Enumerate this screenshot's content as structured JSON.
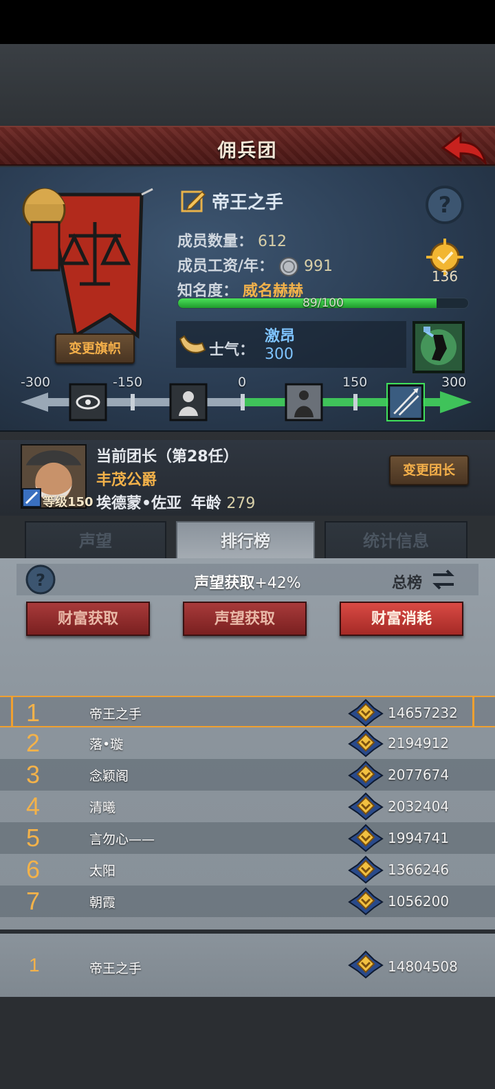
{
  "header": {
    "title": "佣兵团"
  },
  "guild": {
    "name": "帝王之手",
    "member_count_label": "成员数量：",
    "member_count": "612",
    "salary_label": "成员工资/年：",
    "salary": "991",
    "fame_label": "知名度：",
    "fame_rank": "威名赫赫",
    "fame_progress_text": "89/100",
    "fame_progress": 0.89,
    "medal_count": "136",
    "change_flag_label": "变更旗帜"
  },
  "morale": {
    "label": "士气：",
    "state": "激昂",
    "value": "300",
    "scale_labels": [
      "-300",
      "-150",
      "0",
      "150",
      "300"
    ]
  },
  "leader": {
    "title": "当前团长（第28任）",
    "rank_title": "丰茂公爵",
    "name": "埃德蒙•佐亚",
    "age_label": "年龄",
    "age": "279",
    "level_text": "等级150",
    "change_leader_label": "变更团长"
  },
  "tabs": [
    {
      "label": "声望"
    },
    {
      "label": "排行榜"
    },
    {
      "label": "统计信息"
    }
  ],
  "ranking": {
    "bonus_label": "声望获取",
    "bonus_value": "+42%",
    "board_label": "总榜",
    "categories": [
      "财富获取",
      "声望获取",
      "财富消耗"
    ],
    "rows": [
      {
        "rank": "1",
        "name": "帝王之手",
        "score": "14657232"
      },
      {
        "rank": "2",
        "name": "落•璇",
        "score": "2194912"
      },
      {
        "rank": "3",
        "name": "念颖阁",
        "score": "2077674"
      },
      {
        "rank": "4",
        "name": "清曦",
        "score": "2032404"
      },
      {
        "rank": "5",
        "name": "言勿心——",
        "score": "1994741"
      },
      {
        "rank": "6",
        "name": "太阳",
        "score": "1366246"
      },
      {
        "rank": "7",
        "name": "朝霞",
        "score": "1056200"
      }
    ],
    "my_row": {
      "rank": "1",
      "name": "帝王之手",
      "score": "14804508"
    }
  },
  "colors": {
    "accent_gold": "#f3b24a",
    "morale_blue": "#7fc4ff",
    "title_red": "#5a1f1c"
  }
}
